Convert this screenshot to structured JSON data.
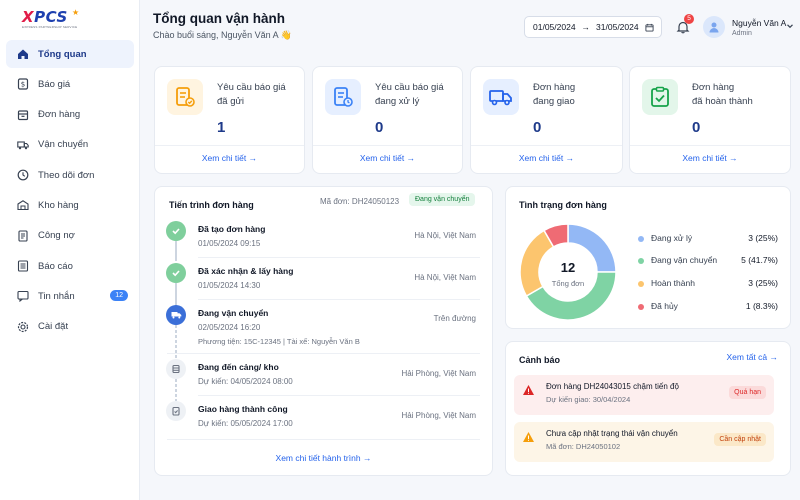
{
  "brand": {
    "logo_letter": "X",
    "logo_rest": "PCS",
    "tagline": "EXPRESS PARTNERSHIP SERVICE"
  },
  "sidebar": {
    "items": [
      {
        "label": "Tổng quan",
        "icon": "home-icon",
        "active": true
      },
      {
        "label": "Báo giá",
        "icon": "dollar-icon"
      },
      {
        "label": "Đơn hàng",
        "icon": "box-icon"
      },
      {
        "label": "Vận chuyển",
        "icon": "truck-icon"
      },
      {
        "label": "Theo dõi đơn",
        "icon": "clock-icon"
      },
      {
        "label": "Kho hàng",
        "icon": "warehouse-icon"
      },
      {
        "label": "Công nợ",
        "icon": "ledger-icon"
      },
      {
        "label": "Báo cáo",
        "icon": "report-icon"
      },
      {
        "label": "Tin nhắn",
        "icon": "message-icon",
        "badge": "12"
      },
      {
        "label": "Cài đặt",
        "icon": "gear-icon"
      }
    ]
  },
  "header": {
    "title": "Tổng quan vận hành",
    "greeting": "Chào buổi sáng, Nguyễn Văn A 👋",
    "date_from": "01/05/2024",
    "date_arrow": "→",
    "date_to": "31/05/2024",
    "notification_count": "5",
    "user_name": "Nguyễn Văn A",
    "user_role": "Admin"
  },
  "stats": [
    {
      "line1": "Yêu cầu báo giá",
      "line2": "đã gửi",
      "value": "1",
      "link": "Xem chi tiết →",
      "icon": "quote-sent-icon",
      "color": "#f59e0b",
      "bg": "#fff4e0"
    },
    {
      "line1": "Yêu cầu báo giá",
      "line2": "đang xử lý",
      "value": "0",
      "link": "Xem chi tiết →",
      "icon": "quote-processing-icon",
      "color": "#3b82f6",
      "bg": "#e6efff"
    },
    {
      "line1": "Đơn hàng",
      "line2": "đang giao",
      "value": "0",
      "link": "Xem chi tiết →",
      "icon": "delivery-truck-icon",
      "color": "#2563eb",
      "bg": "#e6efff"
    },
    {
      "line1": "Đơn hàng",
      "line2": "đã hoàn thành",
      "value": "0",
      "link": "Xem chi tiết →",
      "icon": "completed-clipboard-icon",
      "color": "#16a34a",
      "bg": "#e3f6ea"
    }
  ],
  "progress": {
    "title": "Tiến trình đơn hàng",
    "order_code": "Mã đơn: DH24050123",
    "status": "Đang vận chuyển",
    "steps": [
      {
        "title": "Đã tạo đơn hàng",
        "time": "01/05/2024 09:15",
        "place": "Hà Nội, Việt Nam",
        "state": "done"
      },
      {
        "title": "Đã xác nhận & lấy hàng",
        "time": "01/05/2024 14:30",
        "place": "Hà Nội, Việt Nam",
        "state": "done"
      },
      {
        "title": "Đang vận chuyển",
        "time": "02/05/2024 16:20",
        "place": "Trên đường",
        "extra": "Phương tiện: 15C-12345 | Tài xế: Nguyễn Văn B",
        "state": "current"
      },
      {
        "title": "Đang đến cảng/ kho",
        "time": "Dự kiến: 04/05/2024 08:00",
        "place": "Hải Phòng, Việt Nam",
        "state": "pending"
      },
      {
        "title": "Giao hàng thành công",
        "time": "Dự kiến: 05/05/2024 17:00",
        "place": "Hải Phòng, Việt Nam",
        "state": "pending"
      }
    ],
    "link": "Xem chi tiết hành trình →"
  },
  "order_status": {
    "title": "Tình trạng đơn hàng",
    "total_value": "12",
    "total_label": "Tổng đơn",
    "chart_data": {
      "type": "pie",
      "total": 12,
      "categories": [
        "Đang xử lý",
        "Đang vận chuyển",
        "Hoàn thành",
        "Đã hủy"
      ],
      "values": [
        3,
        5,
        3,
        1
      ],
      "labels": [
        "3 (25%)",
        "5 (41.7%)",
        "3 (25%)",
        "1 (8.3%)"
      ],
      "colors": [
        "#93b8f5",
        "#7fd3a4",
        "#fcc56e",
        "#ef6b74"
      ]
    }
  },
  "alerts": {
    "title": "Cảnh báo",
    "see_all": "Xem tất cả →",
    "items": [
      {
        "title": "Đơn hàng DH24043015 chậm tiến độ",
        "sub": "Dự kiến giao: 30/04/2024",
        "tag": "Quá hạn",
        "bg": "#fdeeee",
        "tag_bg": "#fbdada",
        "tag_color": "#dc2626",
        "icon_color": "#dc2626",
        "icon": "warning-icon"
      },
      {
        "title": "Chưa cập nhật trạng thái vận chuyển",
        "sub": "Mã đơn: DH24050102",
        "tag": "Cần cập nhật",
        "bg": "#fdf5e7",
        "tag_bg": "#fbe8c8",
        "tag_color": "#c2410c",
        "icon_color": "#f59e0b",
        "icon": "warning-icon"
      }
    ]
  }
}
